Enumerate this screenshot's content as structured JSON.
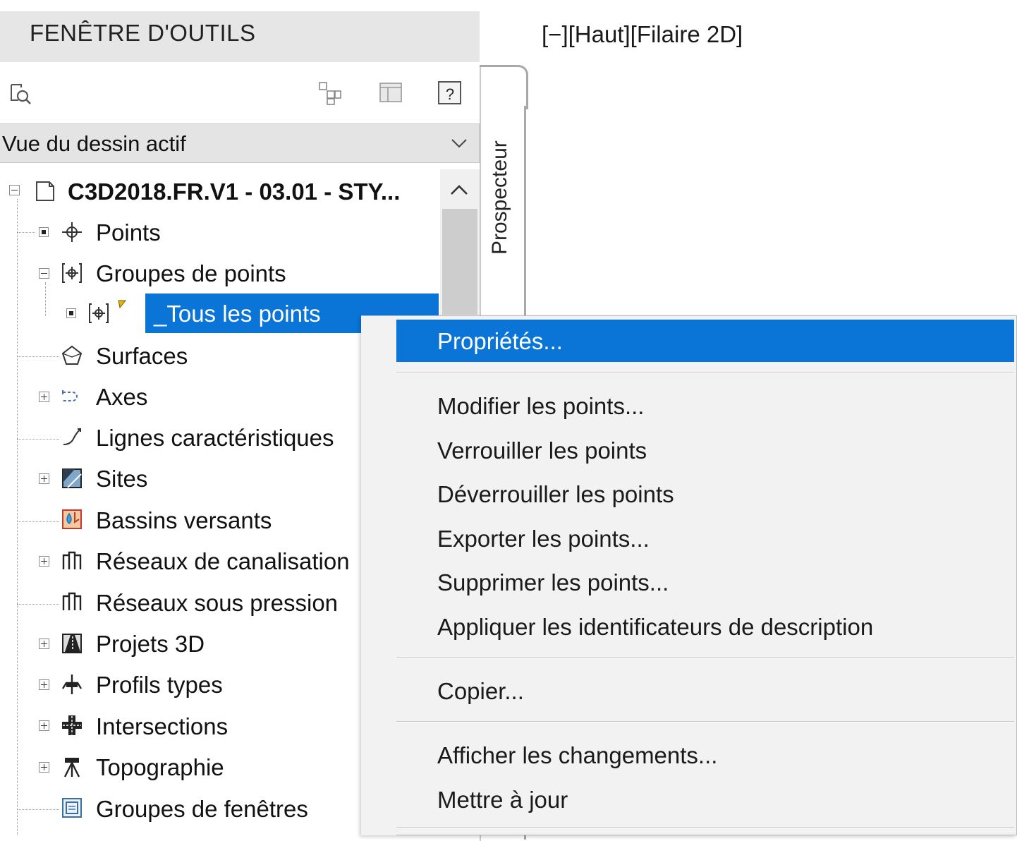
{
  "toolspace": {
    "title": "FENÊTRE D'OUTILS",
    "tab_label": "Prospecteur",
    "view_select": "Vue du dessin actif",
    "tree": {
      "root": "C3D2018.FR.V1 - 03.01 - STY...",
      "items": [
        {
          "label": "Points",
          "icon": "points-icon"
        },
        {
          "label": "Groupes de points",
          "icon": "point-groups-icon"
        },
        {
          "label": "_Tous les points",
          "icon": "point-group-icon"
        },
        {
          "label": "Surfaces",
          "icon": "surfaces-icon"
        },
        {
          "label": "Axes",
          "icon": "alignments-icon"
        },
        {
          "label": "Lignes caractéristiques",
          "icon": "feature-lines-icon"
        },
        {
          "label": "Sites",
          "icon": "sites-icon"
        },
        {
          "label": "Bassins versants",
          "icon": "catchments-icon"
        },
        {
          "label": "Réseaux de canalisation",
          "icon": "pipe-networks-icon"
        },
        {
          "label": "Réseaux sous pression",
          "icon": "pressure-networks-icon"
        },
        {
          "label": "Projets 3D",
          "icon": "corridors-icon"
        },
        {
          "label": "Profils types",
          "icon": "assemblies-icon"
        },
        {
          "label": "Intersections",
          "icon": "intersections-icon"
        },
        {
          "label": "Topographie",
          "icon": "survey-icon"
        },
        {
          "label": "Groupes de fenêtres",
          "icon": "view-frame-groups-icon"
        }
      ]
    }
  },
  "viewport": {
    "label": "[−][Haut][Filaire 2D]"
  },
  "context_menu": {
    "items": [
      {
        "label": "Propriétés..."
      },
      {
        "label": "Modifier les points..."
      },
      {
        "label": "Verrouiller les points"
      },
      {
        "label": "Déverrouiller les points"
      },
      {
        "label": "Exporter les points..."
      },
      {
        "label": "Supprimer les points..."
      },
      {
        "label": "Appliquer les identificateurs de description"
      },
      {
        "label": "Copier..."
      },
      {
        "label": "Afficher les changements..."
      },
      {
        "label": "Mettre à jour"
      }
    ]
  },
  "colors": {
    "selection": "#0b74d7",
    "panel_header": "#e6e6e6",
    "menu_bg": "#f2f2f2"
  }
}
